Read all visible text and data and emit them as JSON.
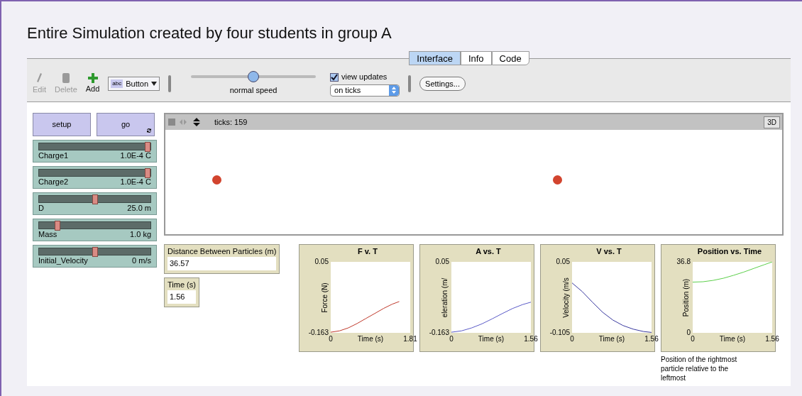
{
  "title": "Entire Simulation created by four students in group A",
  "tabs": [
    {
      "label": "Interface",
      "selected": true
    },
    {
      "label": "Info",
      "selected": false
    },
    {
      "label": "Code",
      "selected": false
    }
  ],
  "toolbar": {
    "tools": [
      {
        "label": "Edit",
        "kind": "edit",
        "disabled": true
      },
      {
        "label": "Delete",
        "kind": "delete",
        "disabled": true
      },
      {
        "label": "Add",
        "kind": "add",
        "disabled": false
      }
    ],
    "widget_picker": {
      "icon_text": "abc",
      "value": "Button"
    },
    "speed": {
      "label": "normal speed",
      "level": 0.5
    },
    "view_updates": {
      "label": "view updates",
      "checked": true
    },
    "update_mode": {
      "value": "on ticks"
    },
    "settings_button": "Settings..."
  },
  "buttons": [
    {
      "label": "setup",
      "forever": false
    },
    {
      "label": "go",
      "forever": true
    }
  ],
  "sliders": [
    {
      "name": "Charge1",
      "reading": "1.0E-4 C",
      "level": 1.0
    },
    {
      "name": "Charge2",
      "reading": "1.0E-4 C",
      "level": 1.0
    },
    {
      "name": "D",
      "reading": "25.0 m",
      "level": 0.5
    },
    {
      "name": "Mass",
      "reading": "1.0 kg",
      "level": 0.15
    },
    {
      "name": "Initial_Velocity",
      "reading": "0 m/s",
      "level": 0.5
    }
  ],
  "view": {
    "ticks": "ticks: 159",
    "three_d_button": "3D"
  },
  "monitors": [
    {
      "label": "Distance Between Particles (m)",
      "value": "36.57"
    },
    {
      "label": "Time (s)",
      "value": "1.56"
    }
  ],
  "plots": [
    {
      "chart_data": {
        "type": "line",
        "title": "F v. T",
        "xlabel": "Time (s)",
        "ylabel": "Force (N)",
        "xlim": [
          0,
          1.81
        ],
        "ylim": [
          -0.163,
          0.05
        ],
        "xticks": [
          0,
          1.81
        ],
        "yticks": [
          -0.163,
          0.05
        ],
        "x": [
          0,
          0.2,
          0.4,
          0.6,
          0.8,
          1.0,
          1.2,
          1.4,
          1.56
        ],
        "series": [
          {
            "color": "#c0392b",
            "values": [
              -0.161,
              -0.157,
              -0.148,
              -0.135,
              -0.12,
              -0.105,
              -0.09,
              -0.077,
              -0.069
            ]
          }
        ]
      }
    },
    {
      "chart_data": {
        "type": "line",
        "title": "A vs. T",
        "xlabel": "Time (s)",
        "ylabel": "eleration (m/",
        "xlim": [
          0,
          1.56
        ],
        "ylim": [
          -0.163,
          0.05
        ],
        "xticks": [
          0,
          1.56
        ],
        "yticks": [
          -0.163,
          0.05
        ],
        "x": [
          0,
          0.2,
          0.4,
          0.6,
          0.8,
          1.0,
          1.2,
          1.4,
          1.56
        ],
        "series": [
          {
            "color": "#5b5bc8",
            "values": [
              -0.161,
              -0.157,
              -0.148,
              -0.136,
              -0.121,
              -0.105,
              -0.09,
              -0.078,
              -0.071
            ]
          }
        ]
      }
    },
    {
      "chart_data": {
        "type": "line",
        "title": "V vs. T",
        "xlabel": "Time (s)",
        "ylabel": "Velocity (m/s",
        "xlim": [
          0,
          1.56
        ],
        "ylim": [
          -0.105,
          0.05
        ],
        "xticks": [
          0,
          1.56
        ],
        "yticks": [
          -0.105,
          0.05
        ],
        "x": [
          0,
          0.2,
          0.4,
          0.6,
          0.8,
          1.0,
          1.2,
          1.4,
          1.56
        ],
        "series": [
          {
            "color": "#3a3aa0",
            "values": [
              0.004,
              -0.015,
              -0.038,
              -0.06,
              -0.077,
              -0.089,
              -0.097,
              -0.102,
              -0.104
            ]
          }
        ]
      }
    },
    {
      "chart_data": {
        "type": "line",
        "title": "Position vs. Time",
        "xlabel": "Time (s)",
        "ylabel": "Position (m)",
        "xlim": [
          0,
          1.56
        ],
        "ylim": [
          0,
          36.8
        ],
        "xticks": [
          0,
          1.56
        ],
        "yticks": [
          0,
          36.8
        ],
        "x": [
          0,
          0.2,
          0.4,
          0.6,
          0.8,
          1.0,
          1.2,
          1.4,
          1.56
        ],
        "series": [
          {
            "color": "#5ccf4a",
            "values": [
              26.3,
              26.5,
              27.2,
              28.3,
              29.8,
              31.5,
              33.4,
              35.3,
              36.8
            ]
          }
        ]
      },
      "caption": "Position of the rightmost particle relative to the leftmost"
    }
  ]
}
